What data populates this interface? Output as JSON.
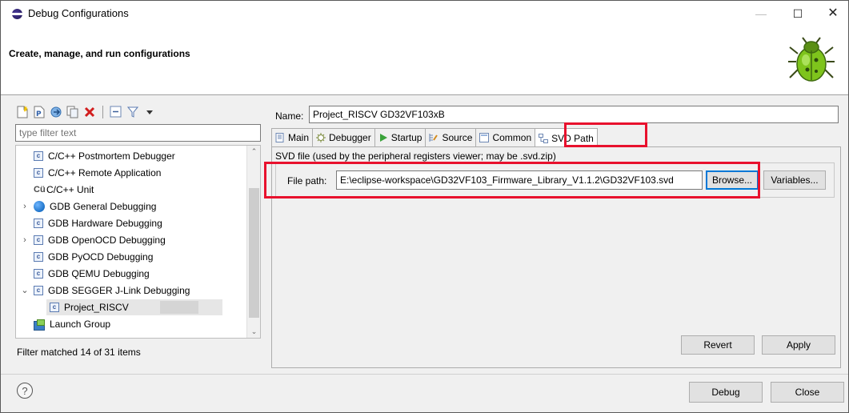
{
  "window": {
    "title": "Debug Configurations",
    "minimize_symbol": "—",
    "maximize_symbol": "☐",
    "close_symbol": "✕"
  },
  "header": {
    "title": "Create, manage, and run configurations",
    "icon": "bug-icon"
  },
  "left_panel": {
    "toolbar_icons": [
      "new-config-icon",
      "new-prototype-icon",
      "export-icon",
      "duplicate-icon",
      "delete-icon",
      "collapse-all-icon",
      "filter-icon",
      "dropdown-icon"
    ],
    "filter_placeholder": "type filter text",
    "tree_items": [
      {
        "label": "C/C++ Postmortem Debugger",
        "icon": "c-icon"
      },
      {
        "label": "C/C++ Remote Application",
        "icon": "c-icon"
      },
      {
        "label": "C/C++ Unit",
        "icon": "cu-icon",
        "icon_text": "Cü"
      },
      {
        "label": "GDB General Debugging",
        "icon": "gdb-icon",
        "expandable": true
      },
      {
        "label": "GDB Hardware Debugging",
        "icon": "c-icon"
      },
      {
        "label": "GDB OpenOCD Debugging",
        "icon": "c-icon",
        "expandable": true
      },
      {
        "label": "GDB PyOCD Debugging",
        "icon": "c-icon"
      },
      {
        "label": "GDB QEMU Debugging",
        "icon": "c-icon"
      },
      {
        "label": "GDB SEGGER J-Link Debugging",
        "icon": "c-icon",
        "expanded": true
      },
      {
        "label": "Project_RISCV",
        "icon": "c-icon",
        "selected": true,
        "child": true
      },
      {
        "label": "Launch Group",
        "icon": "launch-group-icon"
      }
    ],
    "filter_status": "Filter matched 14 of 31 items"
  },
  "right_panel": {
    "name_label": "Name:",
    "name_value": "Project_RISCV GD32VF103xB",
    "tabs": [
      {
        "label": "Main",
        "icon": "main-tab-icon"
      },
      {
        "label": "Debugger",
        "icon": "debugger-tab-icon"
      },
      {
        "label": "Startup",
        "icon": "startup-tab-icon"
      },
      {
        "label": "Source",
        "icon": "source-tab-icon"
      },
      {
        "label": "Common",
        "icon": "common-tab-icon"
      },
      {
        "label": "SVD Path",
        "icon": "svd-path-tab-icon",
        "active": true
      }
    ],
    "svd_description": "SVD file (used by the peripheral registers viewer; may be .svd.zip)",
    "file_path_label": "File path:",
    "file_path_value": "E:\\eclipse-workspace\\GD32VF103_Firmware_Library_V1.1.2\\GD32VF103.svd",
    "browse_label": "Browse...",
    "variables_label": "Variables...",
    "revert_label": "Revert",
    "apply_label": "Apply"
  },
  "footer": {
    "help_symbol": "?",
    "debug_label": "Debug",
    "close_label": "Close"
  },
  "colors": {
    "highlight": "#e8112d",
    "focus": "#0078d7"
  }
}
